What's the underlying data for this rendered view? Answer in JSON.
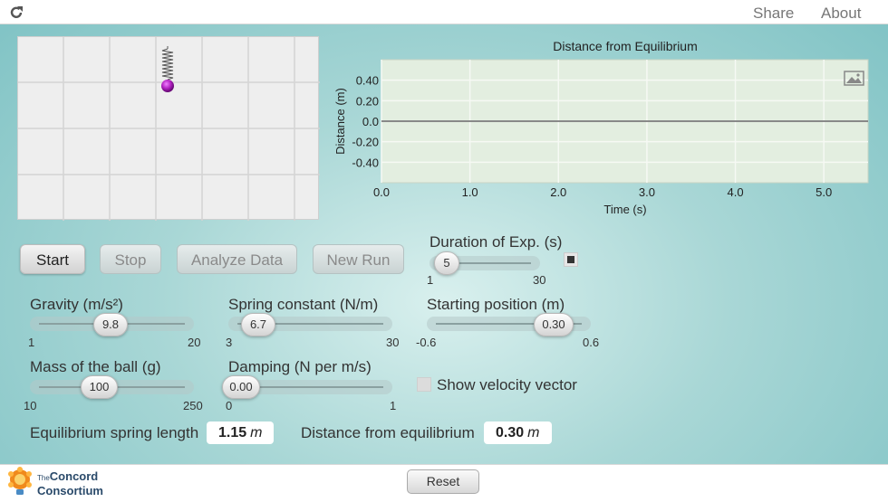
{
  "topbar": {
    "share": "Share",
    "about": "About"
  },
  "simulation": {
    "chart": {
      "title": "Distance from Equilibrium",
      "xlabel": "Time (s)",
      "ylabel": "Distance (m)",
      "x_ticks": [
        "0.0",
        "1.0",
        "2.0",
        "3.0",
        "4.0",
        "5.0"
      ],
      "y_ticks": [
        "0.40",
        "0.20",
        "0.0",
        "-0.20",
        "-0.40"
      ]
    }
  },
  "chart_data": {
    "type": "line",
    "title": "Distance from Equilibrium",
    "xlabel": "Time (s)",
    "ylabel": "Distance (m)",
    "xlim": [
      0,
      5.5
    ],
    "ylim": [
      -0.6,
      0.6
    ],
    "x": [
      0,
      5.5
    ],
    "series": [
      {
        "values": [
          0,
          0
        ]
      }
    ],
    "grid": true
  },
  "buttons": {
    "start": "Start",
    "stop": "Stop",
    "analyze": "Analyze Data",
    "new_run": "New Run"
  },
  "duration": {
    "label": "Duration of Exp. (s)",
    "value": "5",
    "min": "1",
    "max": "30",
    "value_num": 5
  },
  "gravity": {
    "label": "Gravity (m/s²)",
    "value": "9.8",
    "min": "1",
    "max": "20",
    "value_num": 9.8
  },
  "spring": {
    "label": "Spring constant (N/m)",
    "value": "6.7",
    "min": "3",
    "max": "30",
    "value_num": 6.7
  },
  "start_pos": {
    "label": "Starting position (m)",
    "value": "0.30",
    "min": "-0.6",
    "max": "0.6",
    "value_num": 0.3
  },
  "mass": {
    "label": "Mass of the ball (g)",
    "value": "100",
    "min": "10",
    "max": "250",
    "value_num": 100
  },
  "damping": {
    "label": "Damping (N per m/s)",
    "value": "0.00",
    "min": "0",
    "max": "1",
    "value_num": 0
  },
  "velocity_vector": {
    "label": "Show velocity vector"
  },
  "readouts": {
    "eq_length_label": "Equilibrium spring length",
    "eq_length_value": "1.15",
    "eq_length_unit": "m",
    "distance_label": "Distance from equilibrium",
    "distance_value": "0.30",
    "distance_unit": "m"
  },
  "footer": {
    "logo_the": "The",
    "logo_line1": "Concord",
    "logo_line2": "Consortium",
    "reset": "Reset"
  },
  "colors": {
    "ball": "#b020c0",
    "graph_bg": "#e3eee0"
  }
}
